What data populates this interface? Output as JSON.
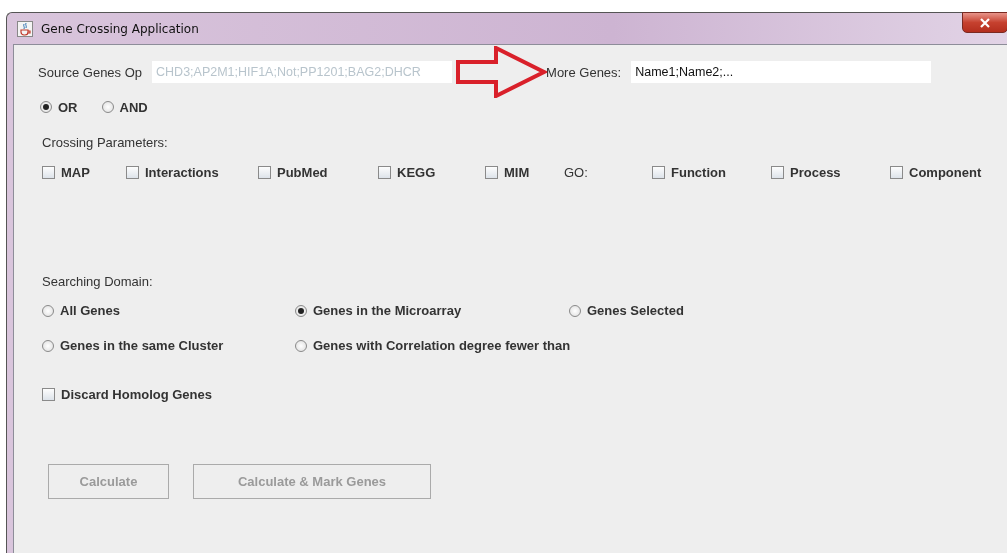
{
  "window": {
    "title": "Gene Crossing Application"
  },
  "source_genes": {
    "label": "Source Genes Op",
    "value": "CHD3;AP2M1;HIF1A;Not;PP1201;BAG2;DHCR",
    "disabled": true
  },
  "more_genes": {
    "label": "More Genes:",
    "value": "Name1;Name2;..."
  },
  "operator": [
    {
      "label": "OR",
      "selected": true
    },
    {
      "label": "AND",
      "selected": false
    }
  ],
  "crossing_parameters": {
    "label": "Crossing Parameters:",
    "items": [
      {
        "kind": "checkbox",
        "label": "MAP",
        "checked": false
      },
      {
        "kind": "checkbox",
        "label": "Interactions",
        "checked": false
      },
      {
        "kind": "checkbox",
        "label": "PubMed",
        "checked": false
      },
      {
        "kind": "checkbox",
        "label": "KEGG",
        "checked": false
      },
      {
        "kind": "checkbox",
        "label": "MIM",
        "checked": false
      },
      {
        "kind": "text",
        "label": "GO:"
      },
      {
        "kind": "checkbox",
        "label": "Function",
        "checked": false
      },
      {
        "kind": "checkbox",
        "label": "Process",
        "checked": false
      },
      {
        "kind": "checkbox",
        "label": "Component",
        "checked": false
      }
    ]
  },
  "searching_domain": {
    "label": "Searching Domain:",
    "options": [
      {
        "label": "All Genes",
        "selected": false
      },
      {
        "label": "Genes in the Microarray",
        "selected": true
      },
      {
        "label": "Genes Selected",
        "selected": false
      },
      {
        "label": "Genes in the same Cluster",
        "selected": false
      },
      {
        "label": "Genes with Correlation degree fewer than",
        "selected": false
      }
    ]
  },
  "discard_homolog": {
    "label": "Discard Homolog Genes",
    "checked": false
  },
  "buttons": [
    {
      "label": "Calculate",
      "disabled": true
    },
    {
      "label": "Calculate & Mark Genes",
      "disabled": true
    }
  ]
}
